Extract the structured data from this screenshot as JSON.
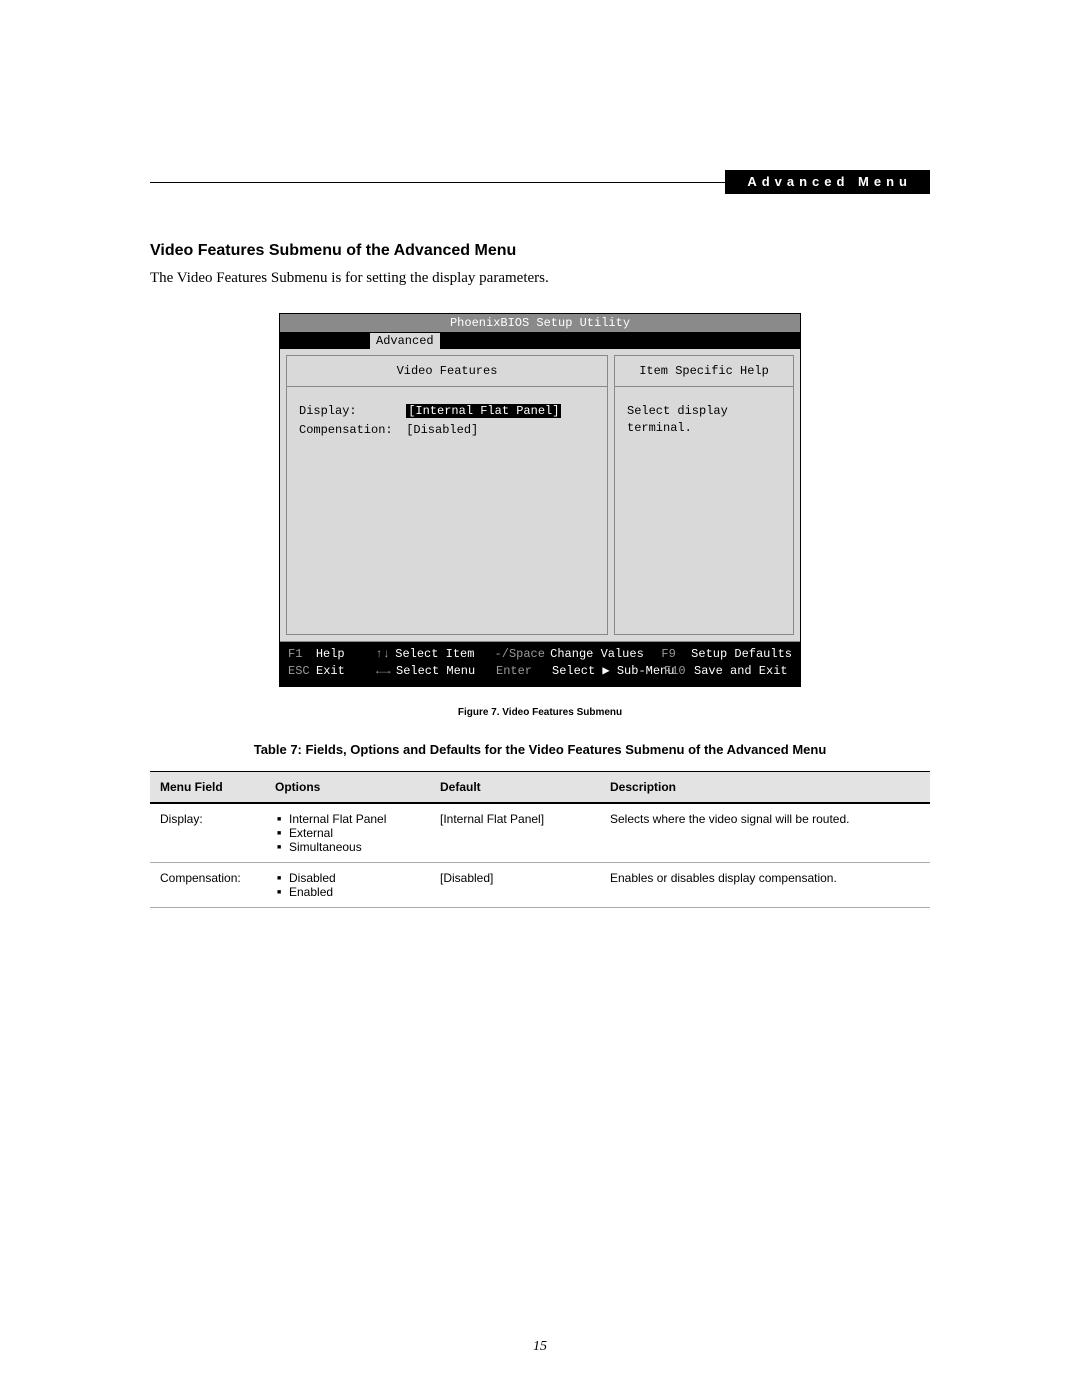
{
  "header": {
    "chapter_label": "Advanced Menu"
  },
  "section": {
    "title": "Video Features Submenu of the Advanced Menu",
    "intro": "The Video Features Submenu is for setting the display parameters."
  },
  "bios": {
    "title": "PhoenixBIOS Setup Utility",
    "active_tab": "Advanced",
    "left_panel_title": "Video Features",
    "right_panel_title": "Item Specific Help",
    "help_text": "Select display terminal.",
    "fields": {
      "display": {
        "label": "Display:",
        "value": "[Internal Flat Panel]",
        "selected": true
      },
      "compensation": {
        "label": "Compensation:",
        "value": "[Disabled]",
        "selected": false
      }
    },
    "footer": {
      "f1": "F1",
      "help": "Help",
      "updown": "↑↓",
      "select_item": "Select Item",
      "minus_space": "-/Space",
      "change_values": "Change Values",
      "f9": "F9",
      "setup_defaults": "Setup Defaults",
      "esc": "ESC",
      "exit": "Exit",
      "leftright": "←→",
      "select_menu": "Select Menu",
      "enter": "Enter",
      "select_submenu": "Select ▶ Sub-Menu",
      "f10": "F10",
      "save_exit": "Save and Exit"
    }
  },
  "figure": {
    "caption": "Figure 7.   Video Features Submenu"
  },
  "table": {
    "caption": "Table 7: Fields, Options and Defaults for the Video Features Submenu of the Advanced Menu",
    "headers": {
      "c1": "Menu Field",
      "c2": "Options",
      "c3": "Default",
      "c4": "Description"
    },
    "rows": [
      {
        "field": "Display:",
        "options": [
          "Internal Flat Panel",
          "External",
          "Simultaneous"
        ],
        "default": "[Internal Flat Panel]",
        "description": "Selects where the video signal will be routed."
      },
      {
        "field": "Compensation:",
        "options": [
          "Disabled",
          "Enabled"
        ],
        "default": "[Disabled]",
        "description": "Enables or disables display compensation."
      }
    ]
  },
  "page_number": "15"
}
